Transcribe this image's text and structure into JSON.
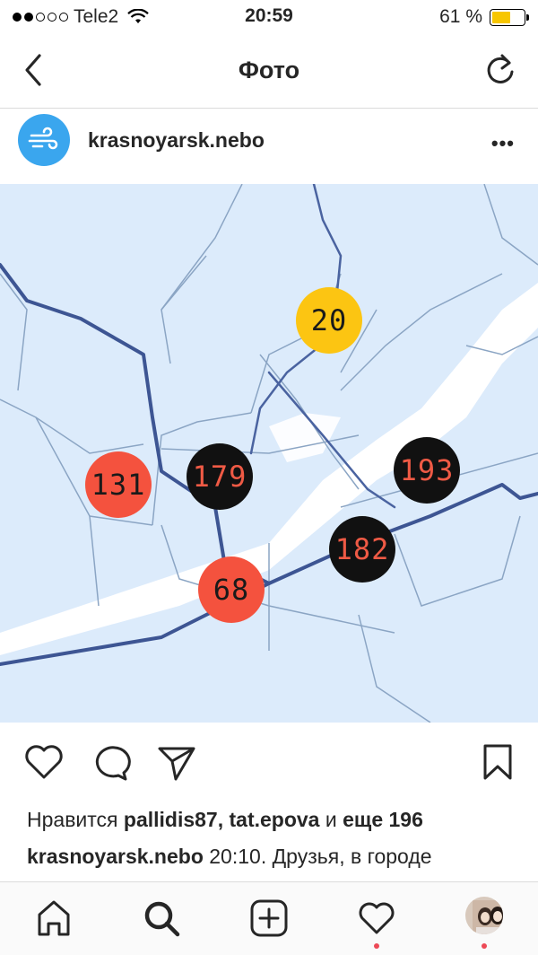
{
  "status_bar": {
    "carrier": "Tele2",
    "time": "20:59",
    "battery_percent": "61 %",
    "battery_level": 0.61,
    "signal_bars": 2
  },
  "nav": {
    "title": "Фото",
    "back_icon": "chevron-left-icon",
    "refresh_icon": "refresh-icon"
  },
  "post": {
    "username": "krasnoyarsk.nebo",
    "more": "•••",
    "avatar_icon": "wind-icon",
    "avatar_color": "#3aa6ee"
  },
  "map_markers": [
    {
      "value": "20",
      "color": "yellow"
    },
    {
      "value": "131",
      "color": "red"
    },
    {
      "value": "179",
      "color": "black"
    },
    {
      "value": "193",
      "color": "black"
    },
    {
      "value": "182",
      "color": "black"
    },
    {
      "value": "68",
      "color": "red"
    }
  ],
  "likes": {
    "prefix": "Нравится ",
    "users": "pallidis87, tat.epova",
    "middle": " и ",
    "count_text": "еще 196"
  },
  "caption": {
    "username": "krasnoyarsk.nebo",
    "text": " 20:10. Друзья, в городе"
  },
  "tabbar": {
    "items": [
      "home-icon",
      "search-icon",
      "add-icon",
      "heart-icon",
      "profile-icon"
    ]
  },
  "colors": {
    "marker_red": "#f4523e",
    "marker_black": "#111111",
    "marker_yellow": "#fcc512",
    "map_bg": "#dcebfb",
    "notification": "#ed4956"
  }
}
